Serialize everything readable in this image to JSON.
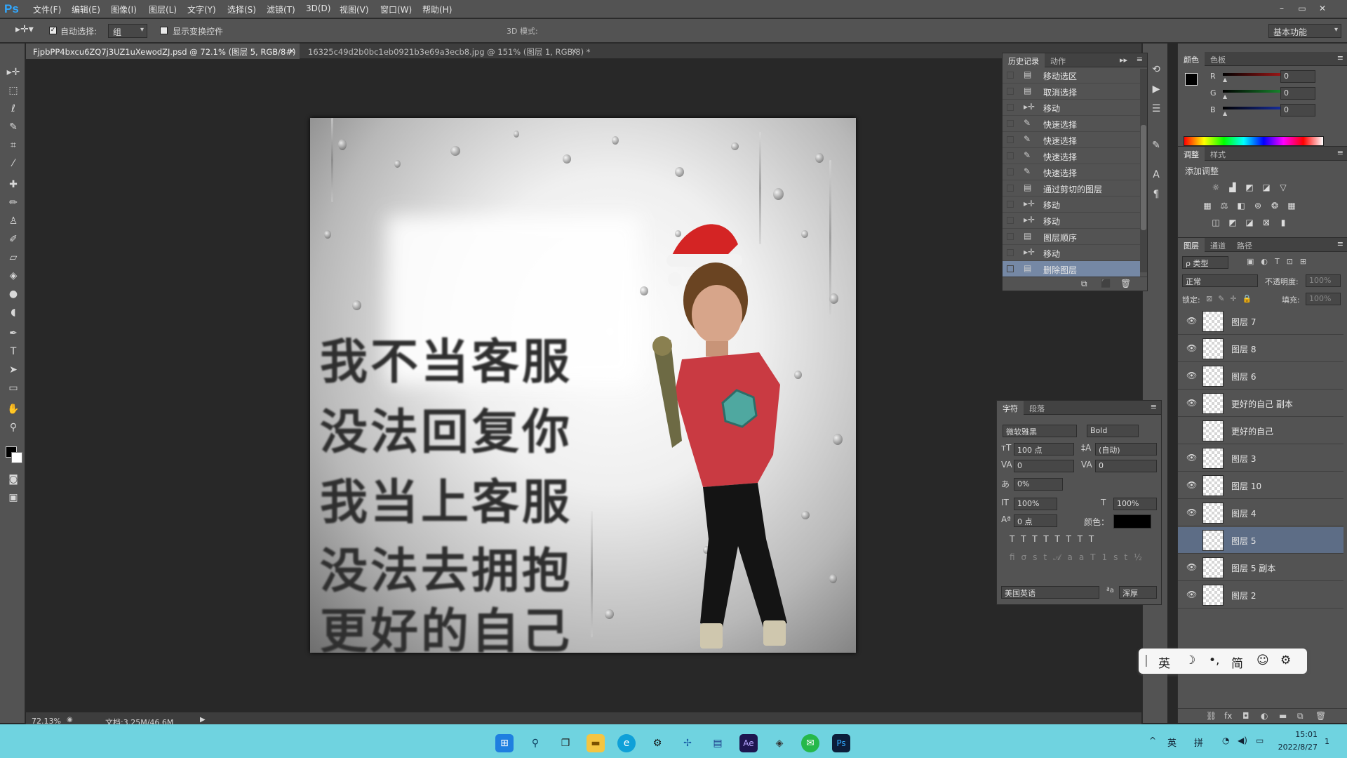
{
  "app": {
    "logo": "Ps",
    "menu": [
      "文件(F)",
      "编辑(E)",
      "图像(I)",
      "图层(L)",
      "文字(Y)",
      "选择(S)",
      "滤镜(T)",
      "3D(D)",
      "视图(V)",
      "窗口(W)",
      "帮助(H)"
    ],
    "window_controls": [
      "–",
      "▭",
      "✕"
    ]
  },
  "options": {
    "auto_select_label": "自动选择:",
    "auto_select_value": "组",
    "show_transform_label": "显示变换控件",
    "mode_3d_label": "3D 模式:",
    "workspace": "基本功能"
  },
  "tabs": [
    {
      "label": "FjpbPP4bxcu6ZQ7j3UZ1uXewodZJ.psd @ 72.1% (图层 5, RGB/8#)",
      "close": "×"
    },
    {
      "label": "16325c49d2b0bc1eb0921b3e69a3ecb8.jpg @ 151% (图层 1, RGB/8) *",
      "close": "×"
    }
  ],
  "artwork": {
    "lines": [
      "我不当客服",
      "没法回复你",
      "我当上客服",
      "没法去拥抱",
      "更好的自己"
    ]
  },
  "status": {
    "zoom": "72.13%",
    "doc": "文档:3.25M/46.6M"
  },
  "history": {
    "tabs": [
      "历史记录",
      "动作"
    ],
    "items": [
      {
        "label": "移动选区",
        "icon": "▤"
      },
      {
        "label": "取消选择",
        "icon": "▤"
      },
      {
        "label": "移动",
        "icon": "▸✛"
      },
      {
        "label": "快速选择",
        "icon": "✎"
      },
      {
        "label": "快速选择",
        "icon": "✎"
      },
      {
        "label": "快速选择",
        "icon": "✎"
      },
      {
        "label": "快速选择",
        "icon": "✎"
      },
      {
        "label": "通过剪切的图层",
        "icon": "▤"
      },
      {
        "label": "移动",
        "icon": "▸✛"
      },
      {
        "label": "移动",
        "icon": "▸✛"
      },
      {
        "label": "图层顺序",
        "icon": "▤"
      },
      {
        "label": "移动",
        "icon": "▸✛"
      },
      {
        "label": "删除图层",
        "icon": "▤"
      }
    ],
    "selected_index": 12
  },
  "character": {
    "tabs": [
      "字符",
      "段落"
    ],
    "font_family": "微软雅黑",
    "font_style": "Bold",
    "size": "100 点",
    "leading": "(自动)",
    "kerning": "0",
    "tracking": "0",
    "scale_pct": "0%",
    "vscale": "100%",
    "hscale": "100%",
    "baseline": "0 点",
    "color_label": "颜色：",
    "language": "美国英语",
    "aa": "浑厚",
    "aa_label": "ªa"
  },
  "color": {
    "tabs": [
      "颜色",
      "色板"
    ],
    "channels": [
      {
        "name": "R",
        "value": "0",
        "color": "#e02020"
      },
      {
        "name": "G",
        "value": "0",
        "color": "#20c040"
      },
      {
        "name": "B",
        "value": "0",
        "color": "#2040e0"
      }
    ]
  },
  "adjust": {
    "tabs": [
      "调整",
      "样式"
    ],
    "title": "添加调整"
  },
  "layers": {
    "tabs": [
      "图层",
      "通道",
      "路径"
    ],
    "filter": "ρ 类型",
    "blend": "正常",
    "opacity_label": "不透明度:",
    "opacity": "100%",
    "lock_label": "锁定:",
    "fill_label": "填充:",
    "fill": "100%",
    "items": [
      {
        "name": "图层 7",
        "visible": true
      },
      {
        "name": "图层 8",
        "visible": true
      },
      {
        "name": "图层 6",
        "visible": true
      },
      {
        "name": "更好的自己 副本",
        "visible": true
      },
      {
        "name": "更好的自己",
        "visible": false
      },
      {
        "name": "图层 3",
        "visible": true
      },
      {
        "name": "图层 10",
        "visible": true
      },
      {
        "name": "图层 4",
        "visible": true
      },
      {
        "name": "图层 5",
        "visible": false,
        "selected": true
      },
      {
        "name": "图层 5 副本",
        "visible": true
      },
      {
        "name": "图层 2",
        "visible": true
      }
    ]
  },
  "ime": {
    "items": [
      "|",
      "英",
      "☽",
      "•,",
      "简",
      "☺",
      "⚙"
    ]
  },
  "taskbar": {
    "tray": [
      "^",
      "英",
      "拼"
    ],
    "time": "15:01",
    "date": "2022/8/27",
    "notif": "1"
  }
}
